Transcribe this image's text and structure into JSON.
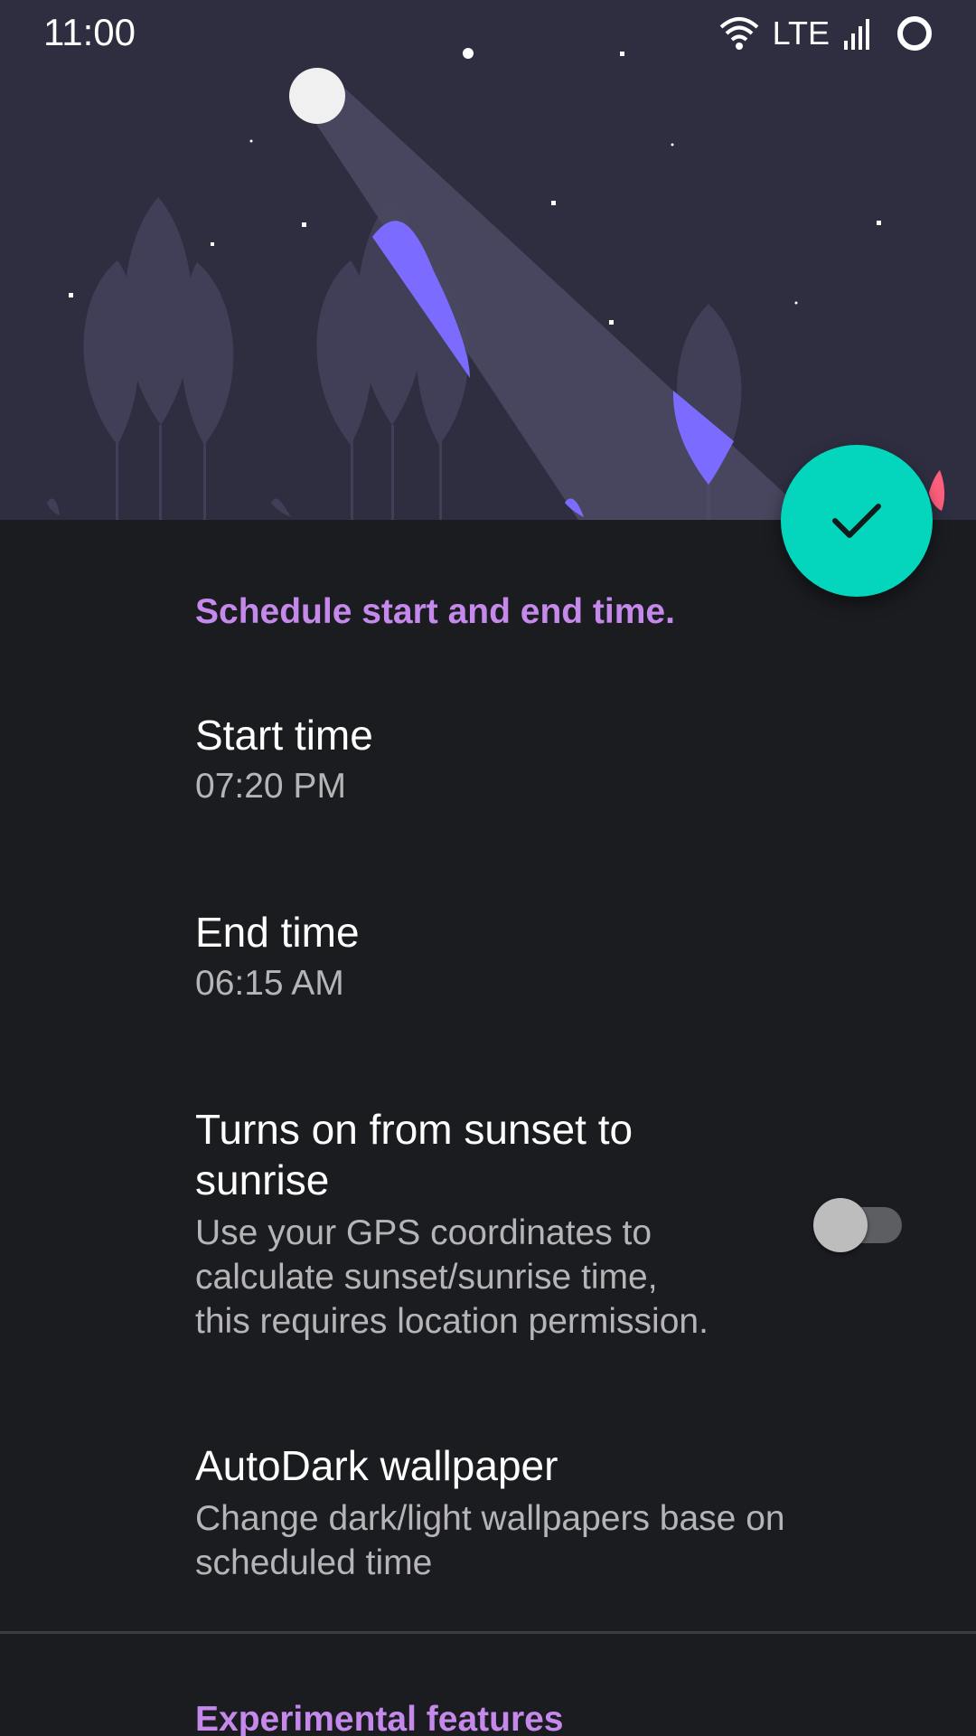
{
  "status_bar": {
    "time": "11:00",
    "network": "LTE",
    "icons": [
      "wifi-icon",
      "signal-icon",
      "circle-status-icon"
    ]
  },
  "colors": {
    "accent": "#c589ec",
    "fab": "#03d6bd",
    "header_bg": "#2f2e40",
    "page_bg": "#1b1c20",
    "illustration_accent": "#7b6cff"
  },
  "fab": {
    "icon": "checkmark-icon"
  },
  "schedule": {
    "header": "Schedule start and end time.",
    "start_time": {
      "title": "Start time",
      "value": "07:20 PM"
    },
    "end_time": {
      "title": "End time",
      "value": "06:15 AM"
    },
    "sunset_sunrise": {
      "title_line1": "Turns on from sunset to",
      "title_line2": "sunrise",
      "summary_line1": "Use your GPS coordinates to",
      "summary_line2": "calculate sunset/sunrise time,",
      "summary_line3": "this requires location permission.",
      "enabled": false
    },
    "wallpaper": {
      "title": "AutoDark wallpaper",
      "summary_line1": "Change dark/light wallpapers base on",
      "summary_line2": "scheduled time"
    }
  },
  "experimental": {
    "header": "Experimental features"
  }
}
